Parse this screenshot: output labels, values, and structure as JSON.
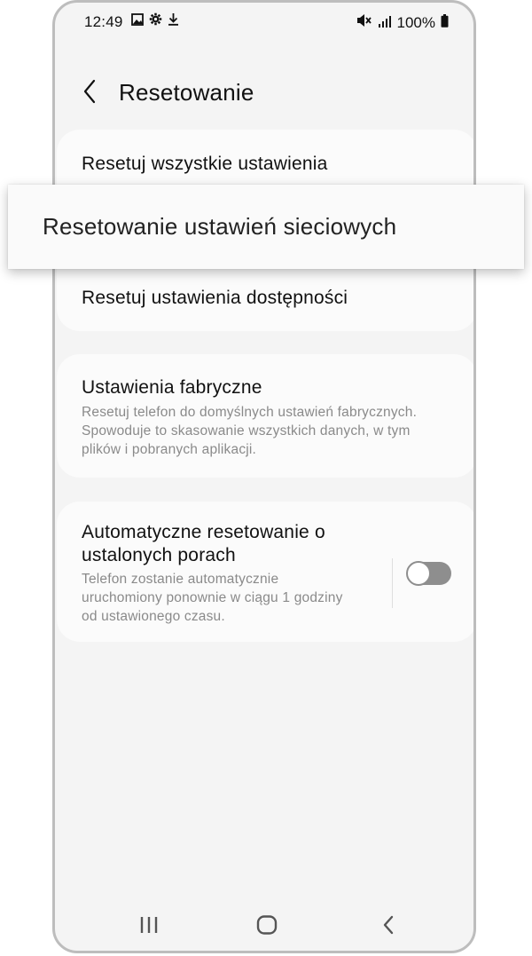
{
  "status_bar": {
    "time": "12:49",
    "battery": "100%",
    "icons_left": [
      "image-icon",
      "gear-icon",
      "download-icon"
    ],
    "icons_right": [
      "mute-icon",
      "signal-icon",
      "battery-icon"
    ]
  },
  "header": {
    "title": "Resetowanie",
    "back_icon": "chevron-left-icon"
  },
  "reset_group": {
    "items": [
      {
        "label": "Resetuj wszystkie ustawienia"
      },
      {
        "label": "Resetowanie ustawień sieciowych"
      },
      {
        "label": "Resetuj ustawienia dostępności"
      }
    ]
  },
  "factory_reset": {
    "title": "Ustawienia fabryczne",
    "description_lines": [
      "Resetuj telefon do domyślnych ustawień fabrycznych.",
      "Spowoduje to skasowanie wszystkich danych, w tym",
      "plików i pobranych aplikacji."
    ]
  },
  "auto_reset": {
    "title_lines": [
      "Automatyczne resetowanie o",
      "ustalonych porach"
    ],
    "description_lines": [
      "Telefon zostanie automatycznie",
      "uruchomiony ponownie w ciągu 1 godziny",
      "od ustawionego czasu."
    ],
    "toggle_on": false
  },
  "nav_bar": {
    "buttons": [
      "recent-apps-icon",
      "home-icon",
      "back-icon"
    ]
  },
  "colors": {
    "background": "#f4f4f4",
    "card": "#fbfbfb",
    "text_primary": "#111111",
    "text_secondary": "#8a8a8a",
    "toggle_off": "#8e8e8e"
  }
}
